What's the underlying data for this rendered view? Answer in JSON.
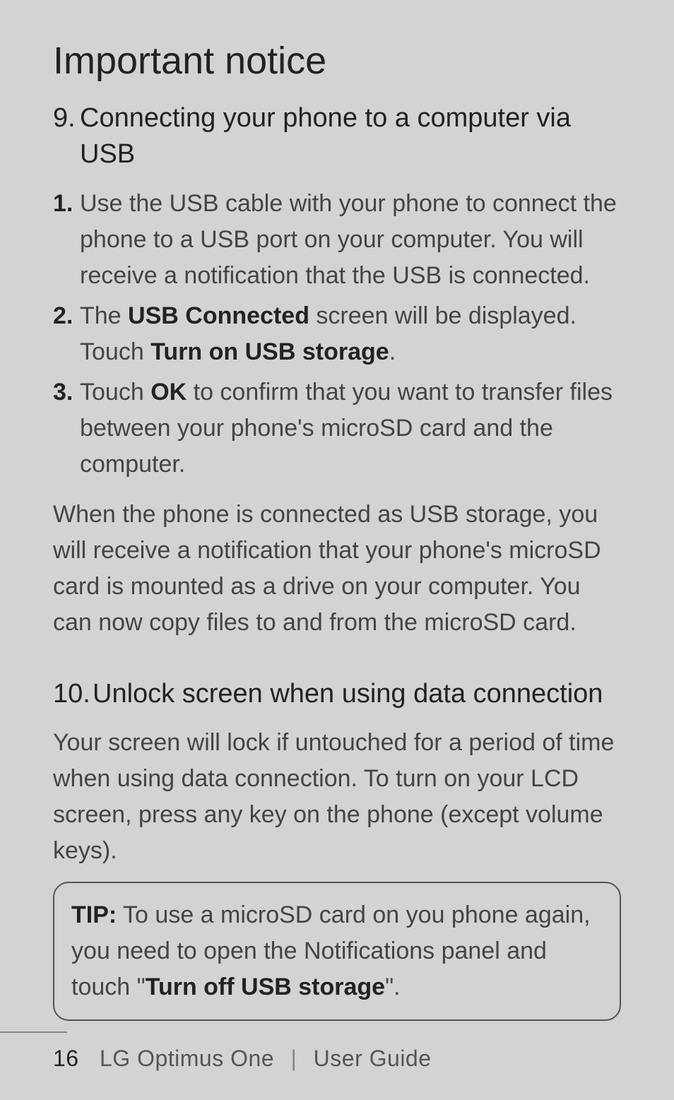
{
  "title": "Important notice",
  "section9": {
    "num": "9.",
    "heading": "Connecting your phone to a computer via USB",
    "steps": [
      {
        "mark": "1.",
        "text": "Use the USB cable with your phone to connect the phone to a USB port on your computer. You will receive a notification that the USB is connected."
      },
      {
        "mark": "2.",
        "prefix": "The ",
        "bold1": "USB Connected",
        "mid": " screen will be displayed. Touch ",
        "bold2": "Turn on USB storage",
        "suffix": "."
      },
      {
        "mark": "3.",
        "prefix": "Touch ",
        "bold1": "OK",
        "suffix": " to confirm that you want to transfer files between your phone's microSD card and the computer."
      }
    ],
    "para": "When the phone is connected as USB storage, you will receive a notification that your phone's microSD card is mounted as a drive on your computer. You can now copy files to and from the microSD card."
  },
  "section10": {
    "num": "10.",
    "heading": "Unlock screen when using data connection",
    "para": "Your screen will lock if untouched for a period of time when using data connection. To turn on your LCD screen, press any key on the phone (except volume keys)."
  },
  "tip": {
    "label": "TIP:",
    "prefix": " To use a microSD card on you phone again, you need to open the Notifications panel and touch \"",
    "bold": "Turn off USB storage",
    "suffix": "\"."
  },
  "footer": {
    "page": "16",
    "product": "LG Optimus One",
    "sep": "|",
    "doc": "User Guide"
  }
}
